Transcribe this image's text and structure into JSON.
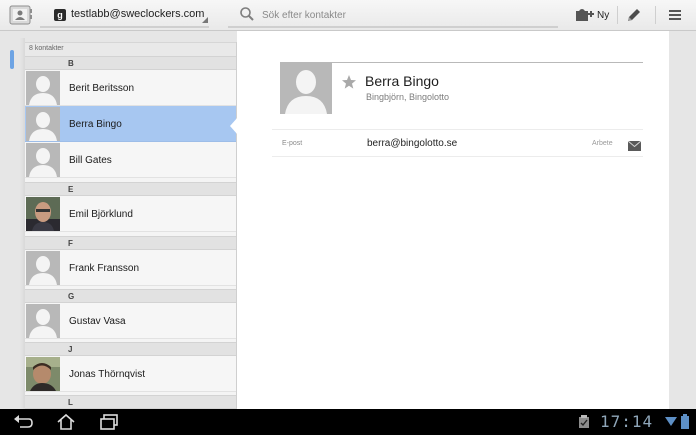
{
  "account": {
    "email": "testlabb@sweclockers.com"
  },
  "search": {
    "placeholder": "Sök efter kontakter"
  },
  "actions": {
    "new_label": "Ny"
  },
  "list": {
    "count_label": "8 kontakter",
    "sections": [
      {
        "letter": "B",
        "contacts": [
          "Berit Beritsson",
          "Berra Bingo",
          "Bill Gates"
        ]
      },
      {
        "letter": "E",
        "contacts": [
          "Emil Björklund"
        ]
      },
      {
        "letter": "F",
        "contacts": [
          "Frank Fransson"
        ]
      },
      {
        "letter": "G",
        "contacts": [
          "Gustav Vasa"
        ]
      },
      {
        "letter": "J",
        "contacts": [
          "Jonas Thörnqvist"
        ]
      },
      {
        "letter": "L",
        "contacts": []
      }
    ],
    "selected": "Berra Bingo"
  },
  "detail": {
    "name": "Berra Bingo",
    "company": "Bingbjörn, Bingolotto",
    "email_kind": "E-post",
    "email": "berra@bingolotto.se",
    "email_type": "Arbete"
  },
  "status": {
    "clock": "17:14"
  },
  "colors": {
    "selection": "#a7c7f1",
    "accent": "#6ea4e4",
    "clock": "#8fa6b9"
  }
}
